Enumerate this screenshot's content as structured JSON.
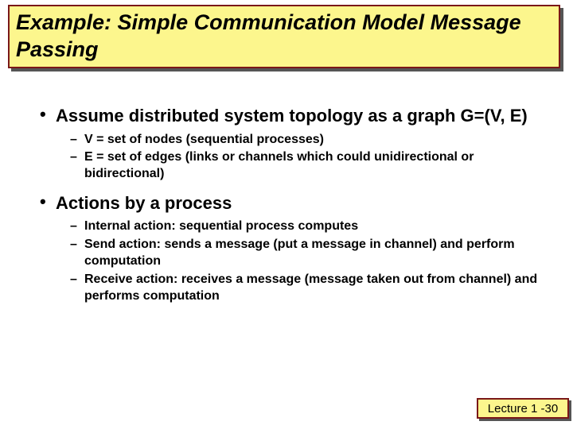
{
  "title": "Example: Simple Communication Model Message Passing",
  "bullets": [
    {
      "text": "Assume distributed system topology as a graph G=(V, E)",
      "sub": [
        "V = set of nodes (sequential processes)",
        "E = set of edges (links or channels which could unidirectional or bidirectional)"
      ]
    },
    {
      "text": "Actions by a process",
      "sub": [
        "Internal action: sequential process computes",
        "Send action: sends a message (put a message in channel) and perform computation",
        "Receive action: receives a message (message taken out from channel) and performs computation"
      ]
    }
  ],
  "footer": "Lecture 1 -30"
}
